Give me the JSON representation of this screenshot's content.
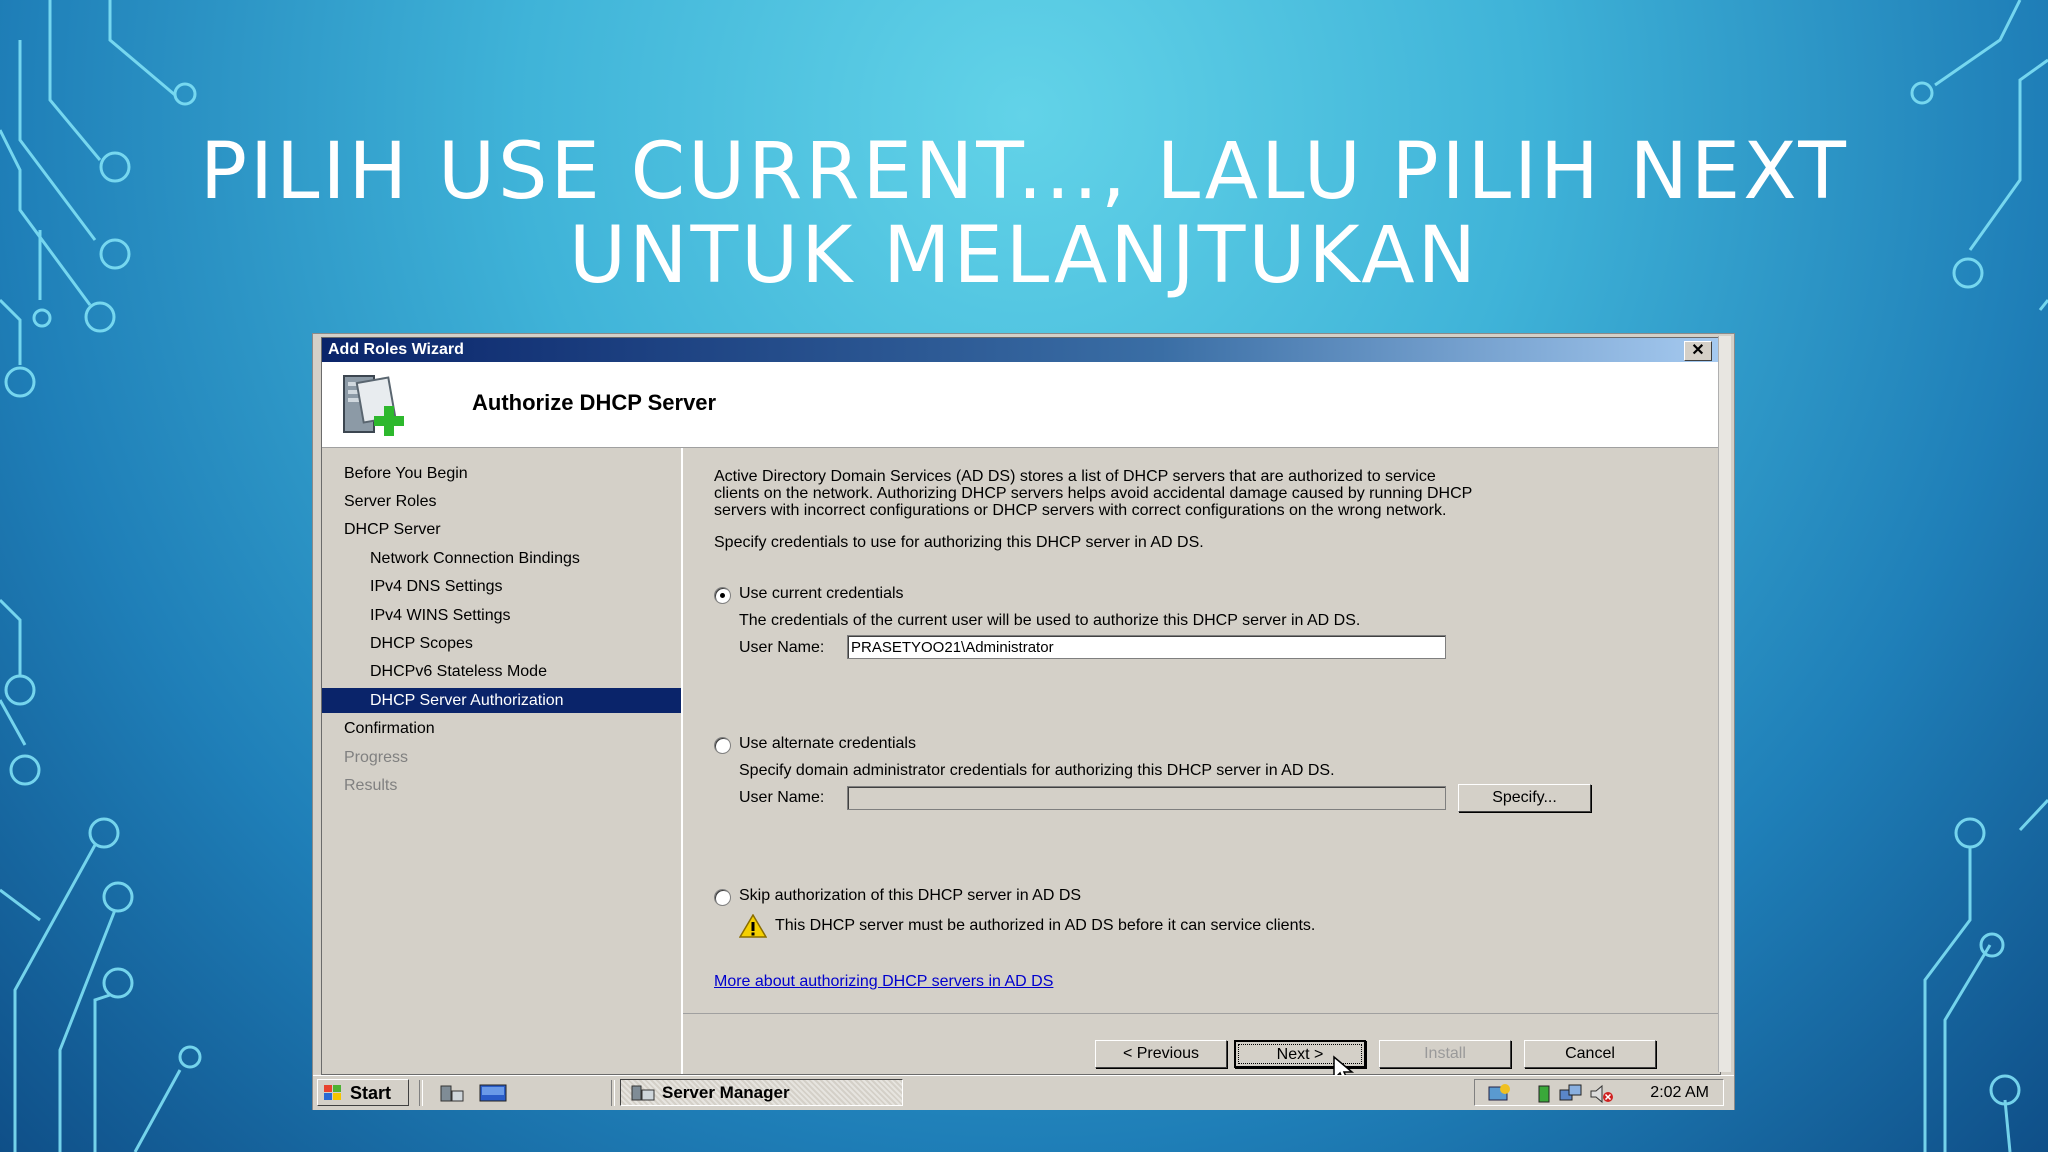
{
  "slide": {
    "title_line1": "PILIH USE CURRENT..., LALU PILIH NEXT",
    "title_line2": "UNTUK MELANJTUKAN"
  },
  "window": {
    "title": "Add Roles Wizard",
    "close_label": "✕"
  },
  "header": {
    "title": "Authorize DHCP Server",
    "icon": "server-add-icon"
  },
  "nav": {
    "items": [
      {
        "label": "Before You Begin",
        "state": "normal"
      },
      {
        "label": "Server Roles",
        "state": "normal"
      },
      {
        "label": "DHCP Server",
        "state": "normal"
      },
      {
        "label": "Network Connection Bindings",
        "state": "normal"
      },
      {
        "label": "IPv4 DNS Settings",
        "state": "normal"
      },
      {
        "label": "IPv4 WINS Settings",
        "state": "normal"
      },
      {
        "label": "DHCP Scopes",
        "state": "normal"
      },
      {
        "label": "DHCPv6 Stateless Mode",
        "state": "normal"
      },
      {
        "label": "DHCP Server Authorization",
        "state": "active"
      },
      {
        "label": "Confirmation",
        "state": "normal"
      },
      {
        "label": "Progress",
        "state": "disabled"
      },
      {
        "label": "Results",
        "state": "disabled"
      }
    ]
  },
  "content": {
    "intro_line1": "Active Directory Domain Services (AD DS) stores a list of DHCP servers that are authorized to service",
    "intro_line2": "clients on the network. Authorizing DHCP servers helps avoid accidental damage caused by running DHCP",
    "intro_line3": "servers with incorrect configurations or DHCP servers with correct configurations on the wrong network.",
    "specify": "Specify credentials to use for authorizing this DHCP server in AD DS.",
    "option_current": {
      "label": "Use current credentials",
      "desc": "The credentials of the current user will be used to authorize this DHCP server in AD DS.",
      "username_label": "User Name:",
      "username_value": "PRASETYOO21\\Administrator",
      "checked": true
    },
    "option_alternate": {
      "label": "Use alternate credentials",
      "desc": "Specify domain administrator credentials for authorizing this DHCP server in AD DS.",
      "username_label": "User Name:",
      "username_value": "",
      "specify_button": "Specify...",
      "checked": false
    },
    "option_skip": {
      "label": "Skip authorization of this DHCP server in AD DS",
      "warning": "This DHCP server must be authorized in AD DS before it can service clients.",
      "checked": false
    },
    "link": "More about authorizing DHCP servers in AD DS"
  },
  "buttons": {
    "previous": "< Previous",
    "next": "Next >",
    "install": "Install",
    "cancel": "Cancel"
  },
  "taskbar": {
    "start": "Start",
    "task": "Server Manager",
    "clock": "2:02 AM"
  },
  "colors": {
    "selection": "#0a246a",
    "link": "#0000cc",
    "dialog_bg": "#d4d0c8"
  }
}
